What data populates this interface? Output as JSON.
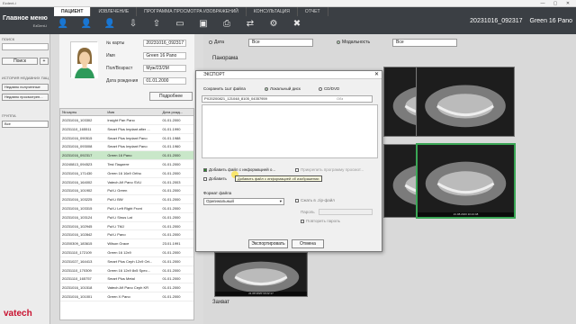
{
  "window": {
    "title": "Ezdent-i",
    "controls": [
      "—",
      "▢",
      "✕"
    ]
  },
  "brand": {
    "title": "Главное меню",
    "subtitle": "EzDent-i"
  },
  "tabs": [
    {
      "label": "ПАЦИЕНТ",
      "active": true
    },
    {
      "label": "ИЗВЛЕЧЕНИЕ",
      "active": false
    },
    {
      "label": "ПРОГРАММА ПРОСМОТРА ИЗОБРАЖЕНИЙ",
      "active": false
    },
    {
      "label": "КОНСУЛЬТАЦИЯ",
      "active": false
    },
    {
      "label": "ОТЧЕТ",
      "active": false
    }
  ],
  "header": {
    "chart_no": "20231016_092317",
    "patient_name": "Green 16 Pano"
  },
  "left_panel": {
    "search_label": "ПОИСК",
    "search_button": "Поиск",
    "add_button": "+",
    "recent_label": "ИСТОРИЯ НЕДАВНИХ ПАЦ",
    "recent_items": [
      "Недавно полученные",
      "Недавно просмотрен..."
    ],
    "group_label": "ГРУППА",
    "group_value": "Все",
    "logo": "vatech"
  },
  "patient_info": {
    "rows": [
      {
        "label": "№ карты",
        "value": "20231016_092317"
      },
      {
        "label": "Имя",
        "value": "Green 16 Pano"
      },
      {
        "label": "Пол/Возраст",
        "value": "Муж/23/2М"
      },
      {
        "label": "Дата рождения",
        "value": "01.01.2000"
      }
    ],
    "more_button": "Подробнее"
  },
  "patient_list": {
    "headers": [
      "№ карты",
      "Имя",
      "Дата рожд..."
    ],
    "rows": [
      [
        "20231016_103302",
        "Insight Pan Pano",
        "01.01.2000"
      ],
      [
        "20231110_165511",
        "Smart Plus Implant after ...",
        "01.01.1990"
      ],
      [
        "20231016_090515",
        "Smart Plus Implant Pano",
        "01.01.1988"
      ],
      [
        "20231016_093008",
        "Smart Plus Implant Pano",
        "01.01.1960"
      ],
      [
        "20231016_092317",
        "Green 16 Pano",
        "01.01.2000"
      ],
      [
        "20240813_094523",
        "Test Пациент",
        "01.01.2000"
      ],
      [
        "20231016_171430",
        "Green 16 16x9 Ortho",
        "01.01.2000"
      ],
      [
        "20231016_164002",
        "Vatech A9 Pano SVU",
        "01.01.2003"
      ],
      [
        "20231016_101902",
        "PaX-i Green",
        "01.01.2000"
      ],
      [
        "20231016_103225",
        "PaX-i BW",
        "01.01.2000"
      ],
      [
        "20231016_103315",
        "PaX-i Left Right Front",
        "01.01.2000"
      ],
      [
        "20231016_103124",
        "PaX-i Sinus Lat",
        "01.01.2000"
      ],
      [
        "20231016_102945",
        "PaX-i TMJ",
        "01.01.2000"
      ],
      [
        "20231016_102842",
        "PaX-i Pano",
        "01.01.2000"
      ],
      [
        "20200309_183615",
        "Wilson Grace",
        "23.01.1991"
      ],
      [
        "20231110_172109",
        "Green 16 12x9",
        "01.01.2000"
      ],
      [
        "20231027_164413",
        "Smart Plus Ceph 12x9 Ort...",
        "01.01.2000"
      ],
      [
        "20231110_170309",
        "Green 16 12x9 8x5 Spec...",
        "01.01.2000"
      ],
      [
        "20231110_165757",
        "Smart Plus Metal",
        "01.01.2000"
      ],
      [
        "20231016_101518",
        "Vatech A9 Pano Ceph KR",
        "01.01.2000"
      ],
      [
        "20231016_101001",
        "Green X Pano",
        "01.01.2000"
      ]
    ],
    "selected_index": 4
  },
  "filters": {
    "date_label": "Дата",
    "date_value": "Все",
    "modality_label": "Модальность",
    "modality_value": "Все"
  },
  "sections": {
    "panorama": "Панорама",
    "capture": "Захват"
  },
  "thumbnails": [
    {
      "caption": "",
      "selected": false
    },
    {
      "caption": "",
      "selected": false
    },
    {
      "caption": "",
      "selected": false
    },
    {
      "caption": "21.08.2020 10:21:48",
      "selected": true
    },
    {
      "caption": "21.08.2020 10:22:17",
      "selected": false
    }
  ],
  "export_dialog": {
    "title": "ЭКСПОРТ",
    "save_label": "Сохранить 1шт файла",
    "radio_local": "Локальный диск",
    "radio_cd": "CD/DVD",
    "path": "PX20200821_121048_8105_04357959",
    "browse": "Обз",
    "chk_include_info": "Добавить файл с информацией о...",
    "chk_viewer": "Прикрепить программу просмот...",
    "chk_second": "Добавить",
    "tooltip": "Добавить файл с информацией об изображении",
    "format_label": "Формат файла",
    "format_value": "Оригинальный",
    "zip_label": "Сжать в .zip-файл",
    "password_label": "Пароль",
    "repeat_password_label": "Повторить пароль",
    "export_button": "Экспортировать",
    "cancel_button": "Отмена"
  },
  "colors": {
    "accent": "#3aa655",
    "brand_red": "#c8102e",
    "topbar": "#3b3f44"
  }
}
